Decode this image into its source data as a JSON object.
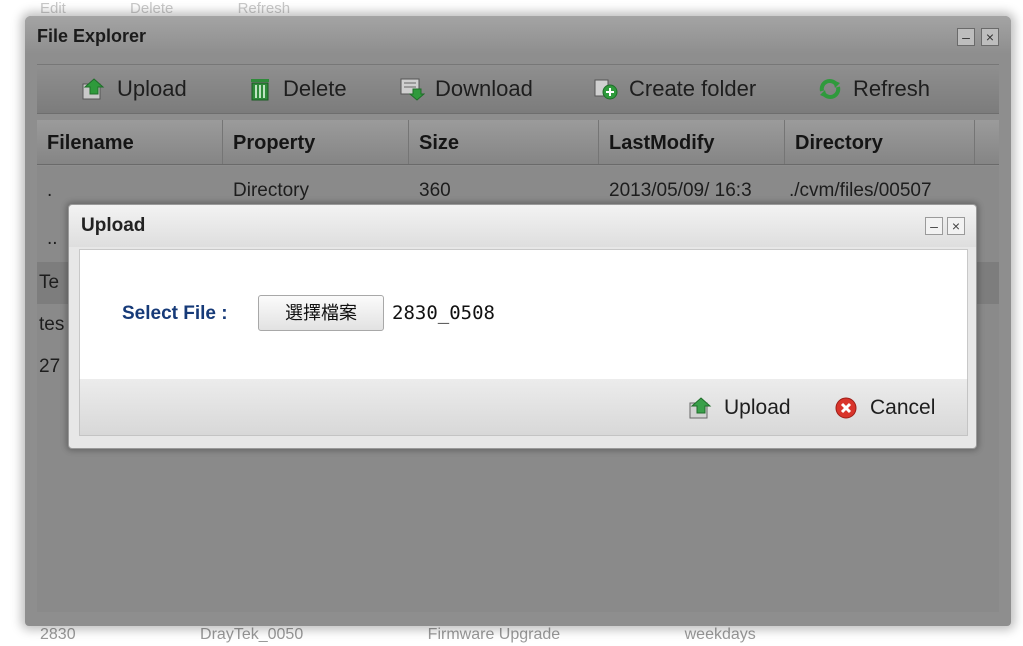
{
  "background_app": {
    "top_strip": [
      "Edit",
      "Delete",
      "Refresh"
    ],
    "bottom_row": [
      "2830",
      "DrayTek_0050",
      "Firmware Upgrade",
      "weekdays"
    ]
  },
  "explorer": {
    "title": "File Explorer",
    "minimize_label": "–",
    "close_label": "×",
    "toolbar": {
      "upload": "Upload",
      "delete": "Delete",
      "download": "Download",
      "create_folder": "Create folder",
      "refresh": "Refresh"
    },
    "columns": [
      "Filename",
      "Property",
      "Size",
      "LastModify",
      "Directory"
    ],
    "rows": [
      {
        "filename": ".",
        "property": "Directory",
        "size": "360",
        "last_modify": "2013/05/09/ 16:3",
        "directory": "./cvm/files/00507"
      },
      {
        "filename": "..",
        "property": "",
        "size": "",
        "last_modify": "",
        "directory": ""
      },
      {
        "filename": "Te",
        "property": "",
        "size": "",
        "last_modify": "",
        "directory": ""
      },
      {
        "filename": "tes",
        "property": "",
        "size": "",
        "last_modify": "",
        "directory": ""
      },
      {
        "filename": "27",
        "property": "",
        "size": "",
        "last_modify": "",
        "directory": ""
      }
    ]
  },
  "upload_dialog": {
    "title": "Upload",
    "minimize_label": "–",
    "close_label": "×",
    "select_file_label": "Select File :",
    "choose_file_button": "選擇檔案",
    "chosen_file": "2830_0508",
    "upload_button": "Upload",
    "cancel_button": "Cancel"
  },
  "colors": {
    "accent_label": "#163a78",
    "upload_icon": "#3aa04a",
    "cancel_icon": "#d9342b",
    "delete_icon": "#2f8a3a"
  }
}
